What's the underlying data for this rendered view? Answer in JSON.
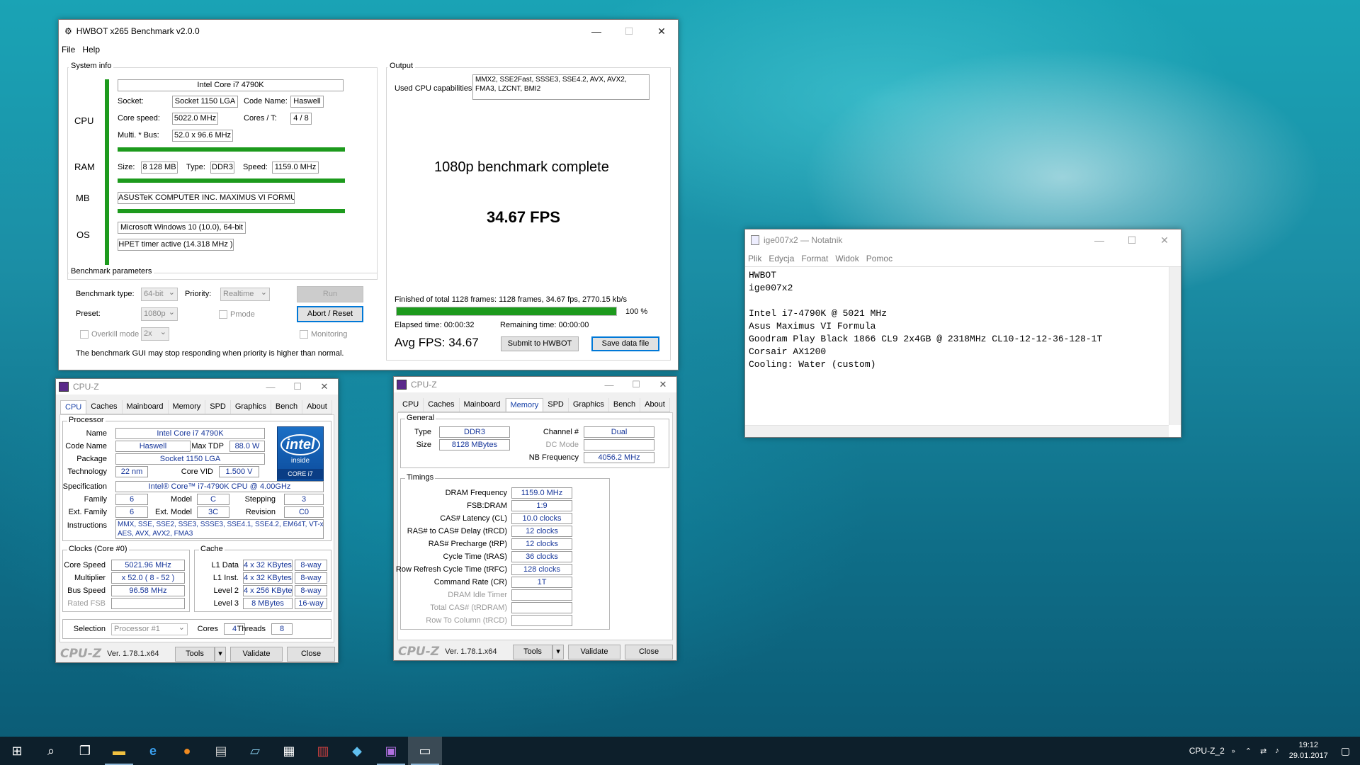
{
  "hwbot": {
    "title": "HWBOT x265 Benchmark v2.0.0",
    "menu": [
      "File",
      "Help"
    ],
    "system_info": {
      "section": "System info",
      "cpu_label": "CPU",
      "ram_label": "RAM",
      "mb_label": "MB",
      "os_label": "OS",
      "cpu_name": "Intel Core i7 4790K",
      "socket_label": "Socket:",
      "socket": "Socket 1150 LGA",
      "codename_label": "Code Name:",
      "codename": "Haswell",
      "corespeed_label": "Core speed:",
      "corespeed": "5022.0 MHz",
      "cores_label": "Cores / T:",
      "cores": "4 / 8",
      "multi_label": "Multi. * Bus:",
      "multi": "52.0 x 96.6 MHz",
      "size_label": "Size:",
      "size": "8 128 MB",
      "type_label": "Type:",
      "type": "DDR3",
      "speed_label": "Speed:",
      "speed": "1159.0 MHz",
      "mb": "ASUSTeK COMPUTER INC. MAXIMUS VI FORMULA",
      "os": "Microsoft Windows 10 (10.0), 64-bit",
      "timer": "HPET timer active (14.318 MHz )"
    },
    "params": {
      "section": "Benchmark parameters",
      "type_label": "Benchmark type:",
      "type": "64-bit",
      "priority_label": "Priority:",
      "priority": "Realtime",
      "run": "Run",
      "preset_label": "Preset:",
      "preset": "1080p",
      "pmode": "Pmode",
      "abort": "Abort / Reset",
      "overkill": "Overkill mode",
      "overkill_val": "2x",
      "monitoring": "Monitoring",
      "note": "The benchmark GUI may stop responding when priority is higher than normal."
    },
    "output": {
      "section": "Output",
      "caps_label": "Used CPU capabilities:",
      "caps_line1": "MMX2, SSE2Fast, SSSE3, SSE4.2, AVX, AVX2,",
      "caps_line2": "FMA3, LZCNT, BMI2",
      "complete": "1080p benchmark complete",
      "fps": "34.67 FPS",
      "finished": "Finished of total 1128 frames: 1128 frames, 34.67 fps,  2770.15 kb/s",
      "progress": 100,
      "progress_text": "100 %",
      "elapsed": "Elapsed time: 00:00:32",
      "remaining": "Remaining time: 00:00:00",
      "avg": "Avg FPS: 34.67",
      "submit": "Submit to HWBOT",
      "save": "Save data file"
    },
    "colors": {
      "green": "#1d9a1d"
    }
  },
  "cpuz1": {
    "title": "CPU-Z",
    "tabs": [
      "CPU",
      "Caches",
      "Mainboard",
      "Memory",
      "SPD",
      "Graphics",
      "Bench",
      "About"
    ],
    "processor": "Processor",
    "name_label": "Name",
    "name": "Intel Core i7 4790K",
    "codename_label": "Code Name",
    "codename": "Haswell",
    "tdp_label": "Max TDP",
    "tdp": "88.0 W",
    "package_label": "Package",
    "package": "Socket 1150 LGA",
    "tech_label": "Technology",
    "tech": "22 nm",
    "vid_label": "Core VID",
    "vid": "1.500 V",
    "spec_label": "Specification",
    "spec": "Intel® Core™ i7-4790K CPU @ 4.00GHz",
    "family_label": "Family",
    "family": "6",
    "model_label": "Model",
    "model": "C",
    "stepping_label": "Stepping",
    "stepping": "3",
    "extfam_label": "Ext. Family",
    "extfam": "6",
    "extmodel_label": "Ext. Model",
    "extmodel": "3C",
    "revision_label": "Revision",
    "revision": "C0",
    "instr_label": "Instructions",
    "instr1": "MMX, SSE, SSE2, SSE3, SSSE3, SSE4.1, SSE4.2, EM64T, VT-x,",
    "instr2": "AES, AVX, AVX2, FMA3",
    "intel_logo": "intel",
    "intel_inside": "inside",
    "intel_core": "CORE i7",
    "clocks": "Clocks (Core #0)",
    "corespeed_label": "Core Speed",
    "corespeed": "5021.96 MHz",
    "mult_label": "Multiplier",
    "mult": "x 52.0 ( 8 - 52 )",
    "bus_label": "Bus Speed",
    "bus": "96.58 MHz",
    "fsb_label": "Rated FSB",
    "cache": "Cache",
    "l1d_label": "L1 Data",
    "l1d": "4 x 32 KBytes",
    "l1d_w": "8-way",
    "l1i_label": "L1 Inst.",
    "l1i": "4 x 32 KBytes",
    "l1i_w": "8-way",
    "l2_label": "Level 2",
    "l2": "4 x 256 KBytes",
    "l2_w": "8-way",
    "l3_label": "Level 3",
    "l3": "8 MBytes",
    "l3_w": "16-way",
    "selection_label": "Selection",
    "selection": "Processor #1",
    "cores_label": "Cores",
    "cores": "4",
    "threads_label": "Threads",
    "threads": "8",
    "logo": "CPU-Z",
    "version": "Ver. 1.78.1.x64",
    "tools": "Tools",
    "validate": "Validate",
    "close": "Close"
  },
  "cpuz2": {
    "title": "CPU-Z",
    "tabs": [
      "CPU",
      "Caches",
      "Mainboard",
      "Memory",
      "SPD",
      "Graphics",
      "Bench",
      "About"
    ],
    "general": "General",
    "type_label": "Type",
    "type": "DDR3",
    "channel_label": "Channel #",
    "channel": "Dual",
    "size_label": "Size",
    "size": "8128 MBytes",
    "dc_label": "DC Mode",
    "nb_label": "NB Frequency",
    "nb": "4056.2 MHz",
    "timings": "Timings",
    "t_labels": [
      "DRAM Frequency",
      "FSB:DRAM",
      "CAS# Latency (CL)",
      "RAS# to CAS# Delay (tRCD)",
      "RAS# Precharge (tRP)",
      "Cycle Time (tRAS)",
      "Row Refresh Cycle Time (tRFC)",
      "Command Rate (CR)",
      "DRAM Idle Timer",
      "Total CAS# (tRDRAM)",
      "Row To Column (tRCD)"
    ],
    "t_values": [
      "1159.0 MHz",
      "1:9",
      "10.0 clocks",
      "12 clocks",
      "12 clocks",
      "36 clocks",
      "128 clocks",
      "1T",
      "",
      "",
      ""
    ],
    "logo": "CPU-Z",
    "version": "Ver. 1.78.1.x64",
    "tools": "Tools",
    "validate": "Validate",
    "close": "Close"
  },
  "notepad": {
    "title": "ige007x2 — Notatnik",
    "menu": [
      "Plik",
      "Edycja",
      "Format",
      "Widok",
      "Pomoc"
    ],
    "lines": [
      "HWBOT",
      "ige007x2",
      "",
      "Intel i7-4790K @ 5021 MHz",
      "Asus Maximus VI Formula",
      "Goodram Play Black 1866 CL9 2x4GB @ 2318MHz CL10-12-12-36-128-1T",
      "Corsair AX1200",
      "Cooling: Water (custom)"
    ]
  },
  "taskbar": {
    "tray_label": "CPU-Z_2",
    "time": "19:12",
    "date": "29.01.2017"
  }
}
